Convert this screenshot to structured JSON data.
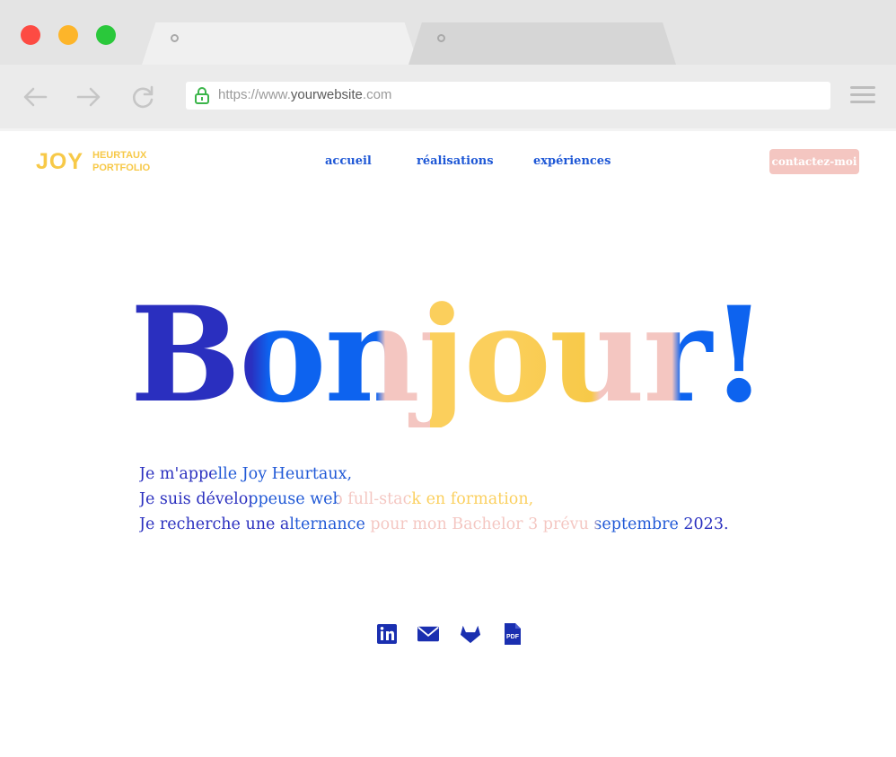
{
  "browser": {
    "url_prefix": "https://www.",
    "url_host": "yourwebsite",
    "url_suffix": ".com",
    "icons": [
      "back-arrow-icon",
      "forward-arrow-icon",
      "reload-icon",
      "lock-icon",
      "hamburger-menu-icon"
    ]
  },
  "site": {
    "logo": {
      "name": "JOY",
      "line1": "HEURTAUX",
      "line2": "PORTFOLIO"
    },
    "nav": [
      {
        "label": "accueil"
      },
      {
        "label": "réalisations"
      },
      {
        "label": "expériences"
      }
    ],
    "contact_label": "contactez-moi",
    "hero_title": "Bonjour!",
    "intro": {
      "line1": "Je m'appelle Joy Heurtaux,",
      "line2": "Je suis développeuse web full-stack en formation,",
      "line3": "Je recherche une alternance pour mon Bachelor 3 prévu septembre 2023."
    },
    "socials": [
      {
        "icon": "linkedin-icon",
        "label": "in"
      },
      {
        "icon": "mail-icon"
      },
      {
        "icon": "gitlab-icon"
      },
      {
        "icon": "pdf-icon",
        "label": "PDF"
      }
    ]
  },
  "colors": {
    "logo_yellow": "#f7c948",
    "nav_blue": "#1f58d6",
    "deep_blue": "#2a2fbf",
    "bright_blue": "#0d63ef",
    "pink": "#f4c6c1",
    "yellow": "#fbcf5c",
    "icon_blue": "#1a2fb0"
  }
}
